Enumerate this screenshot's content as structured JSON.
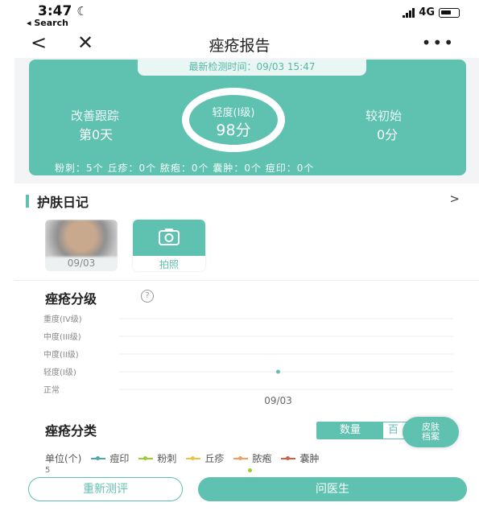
{
  "status_bar": {
    "time": "3:47",
    "back_app": "◂ Search",
    "network": "4G"
  },
  "nav": {
    "title": "痤疮报告",
    "back_icon": "chevron-left-icon",
    "close_icon": "close-icon",
    "more_icon": "more-icon"
  },
  "summary": {
    "latest_test": "最新检测时间：09/03 15:47",
    "improve_label": "改善跟踪",
    "improve_value": "第0天",
    "level_label": "轻度(I级)",
    "score": "98分",
    "compare_label": "较初始",
    "compare_value": "0分",
    "counts": "粉刺：5个  丘疹：0个  脓疱：0个  囊肿：0个  痘印：0个"
  },
  "diary": {
    "title": "护肤日记",
    "photo_date": "09/03",
    "camera_label": "拍照"
  },
  "grading": {
    "title": "痤疮分级"
  },
  "chart_data": {
    "type": "scatter",
    "y_categories": [
      "重度(IV级)",
      "中度(III级)",
      "中度(II级)",
      "轻度(I级)",
      "正常"
    ],
    "x": [
      "09/03"
    ],
    "values": [
      "轻度(I级)"
    ],
    "grid": true,
    "point_color": "#5fc1b0"
  },
  "classification": {
    "title": "痤疮分类",
    "toggle_on": "数量",
    "toggle_off": "百",
    "skin_badge_line1": "皮肤",
    "skin_badge_line2": "档案",
    "unit": "单位(个)",
    "legend": [
      {
        "name": "痘印",
        "color": "#4aa8a8"
      },
      {
        "name": "粉刺",
        "color": "#9acd32"
      },
      {
        "name": "丘疹",
        "color": "#f0c040"
      },
      {
        "name": "脓疱",
        "color": "#f0a060"
      },
      {
        "name": "囊肿",
        "color": "#d06040"
      }
    ],
    "axis_top": "5"
  },
  "actions": {
    "retest": "重新测评",
    "ask_doctor": "问医生"
  },
  "colors": {
    "accent": "#5fc1b0"
  }
}
